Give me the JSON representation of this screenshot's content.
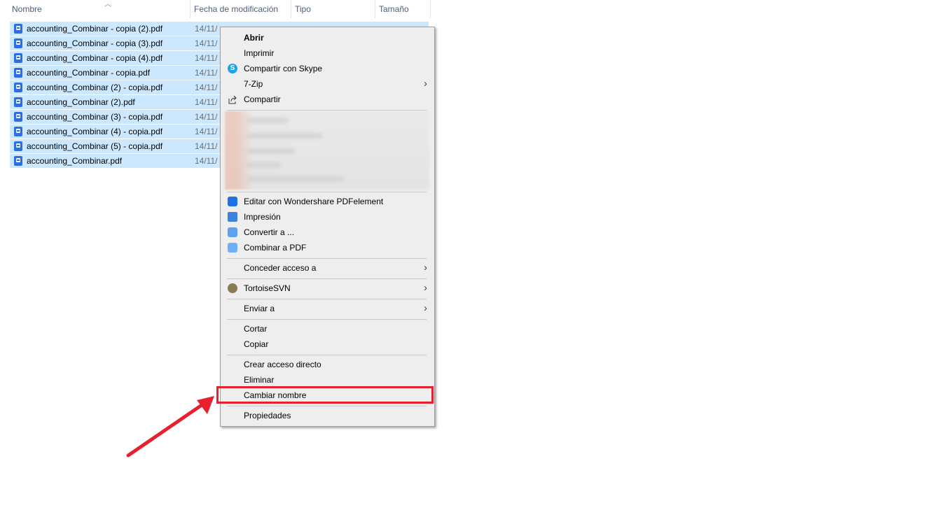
{
  "columns": {
    "name": "Nombre",
    "date": "Fecha de modificación",
    "type": "Tipo",
    "size": "Tamaño"
  },
  "files": [
    {
      "name": "accounting_Combinar - copia (2).pdf",
      "date": "14/11/"
    },
    {
      "name": "accounting_Combinar - copia (3).pdf",
      "date": "14/11/"
    },
    {
      "name": "accounting_Combinar - copia (4).pdf",
      "date": "14/11/"
    },
    {
      "name": "accounting_Combinar - copia.pdf",
      "date": "14/11/"
    },
    {
      "name": "accounting_Combinar (2) - copia.pdf",
      "date": "14/11/"
    },
    {
      "name": "accounting_Combinar (2).pdf",
      "date": "14/11/"
    },
    {
      "name": "accounting_Combinar (3) - copia.pdf",
      "date": "14/11/"
    },
    {
      "name": "accounting_Combinar (4) - copia.pdf",
      "date": "14/11/"
    },
    {
      "name": "accounting_Combinar (5) - copia.pdf",
      "date": "14/11/"
    },
    {
      "name": "accounting_Combinar.pdf",
      "date": "14/11/"
    }
  ],
  "menu": {
    "open": "Abrir",
    "print": "Imprimir",
    "skype": "Compartir con Skype",
    "zip": "7-Zip",
    "share": "Compartir",
    "pdfelement": "Editar con Wondershare PDFelement",
    "impresion": "Impresión",
    "convert": "Convertir a ...",
    "combine": "Combinar a PDF",
    "grant_access": "Conceder acceso a",
    "tortoise": "TortoiseSVN",
    "send_to": "Enviar a",
    "cut": "Cortar",
    "copy": "Copiar",
    "shortcut": "Crear acceso directo",
    "delete": "Eliminar",
    "rename": "Cambiar nombre",
    "properties": "Propiedades"
  },
  "icons": {
    "sort": "chevron-up-icon",
    "file": "pdf-file-icon",
    "skype": "skype-icon",
    "share": "share-icon",
    "submenu": "chevron-right-icon"
  },
  "colors": {
    "selection": "#cce8ff",
    "highlight": "#e8202e",
    "menu_bg": "#eeeeee"
  }
}
